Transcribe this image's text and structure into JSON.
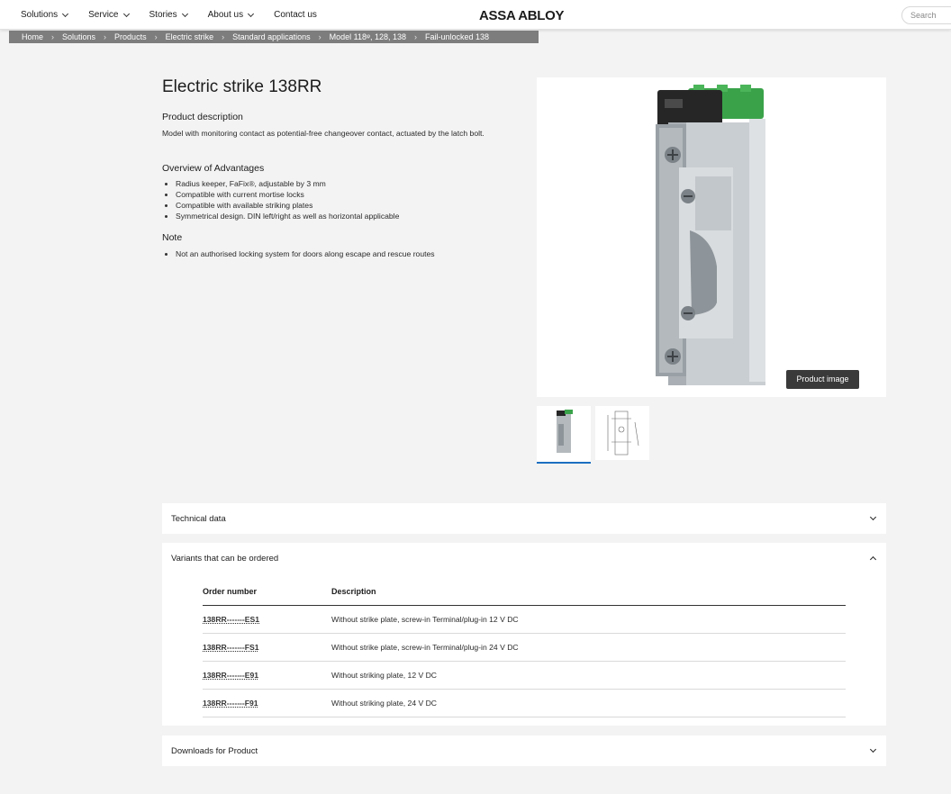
{
  "header": {
    "nav": [
      {
        "label": "Solutions",
        "dropdown": true
      },
      {
        "label": "Service",
        "dropdown": true
      },
      {
        "label": "Stories",
        "dropdown": true
      },
      {
        "label": "About us",
        "dropdown": true
      },
      {
        "label": "Contact us",
        "dropdown": false
      }
    ],
    "logo": "ASSA ABLOY",
    "search_placeholder": "Search"
  },
  "breadcrumb": [
    "Home",
    "Solutions",
    "Products",
    "Electric strike",
    "Standard applications",
    "Model 118ᵠ, 128, 138",
    "Fail-unlocked 138"
  ],
  "product": {
    "title": "Electric strike 138RR",
    "description_heading": "Product description",
    "description": "Model with monitoring contact as potential-free changeover contact, actuated by the latch bolt.",
    "advantages_heading": "Overview of Advantages",
    "advantages": [
      "Radius keeper, FaFix®, adjustable by 3 mm",
      "Compatible with current mortise locks",
      "Compatible with available striking plates",
      "Symmetrical design. DIN left/right as well as horizontal applicable"
    ],
    "note_heading": "Note",
    "notes": [
      "Not an authorised locking system for doors along escape and rescue routes"
    ],
    "image_badge": "Product image"
  },
  "accordions": {
    "technical": "Technical data",
    "variants": "Variants that can be ordered",
    "downloads": "Downloads for Product"
  },
  "variants_table": {
    "headers": [
      "Order number",
      "Description"
    ],
    "rows": [
      {
        "order": "138RR-------ES1",
        "desc": "Without strike plate, screw-in Terminal/plug-in 12 V DC"
      },
      {
        "order": "138RR-------FS1",
        "desc": "Without strike plate, screw-in Terminal/plug-in 24 V DC"
      },
      {
        "order": "138RR-------E91",
        "desc": "Without striking plate, 12 V DC"
      },
      {
        "order": "138RR-------F91",
        "desc": "Without striking plate, 24 V DC"
      }
    ]
  }
}
